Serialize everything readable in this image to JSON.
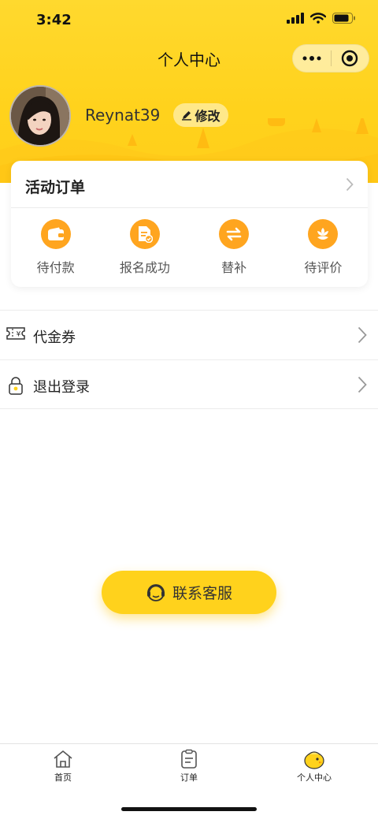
{
  "status_bar": {
    "time": "3:42"
  },
  "nav": {
    "title": "个人中心"
  },
  "profile": {
    "username": "Reynat39",
    "edit_label": "修改"
  },
  "orders_card": {
    "title": "活动订单",
    "items": [
      {
        "label": "待付款",
        "icon": "wallet-icon"
      },
      {
        "label": "报名成功",
        "icon": "document-check-icon"
      },
      {
        "label": "替补",
        "icon": "swap-arrows-icon"
      },
      {
        "label": "待评价",
        "icon": "flower-icon"
      }
    ]
  },
  "menu": [
    {
      "label": "代金券",
      "icon": "voucher-icon"
    },
    {
      "label": "退出登录",
      "icon": "lock-icon"
    }
  ],
  "contact": {
    "label": "联系客服",
    "icon": "headset-icon"
  },
  "tabbar": [
    {
      "label": "首页",
      "icon": "home-icon"
    },
    {
      "label": "订单",
      "icon": "clipboard-icon"
    },
    {
      "label": "个人中心",
      "icon": "chick-icon"
    }
  ],
  "colors": {
    "brand_yellow": "#ffd21c",
    "icon_orange": "#ffa51f"
  }
}
